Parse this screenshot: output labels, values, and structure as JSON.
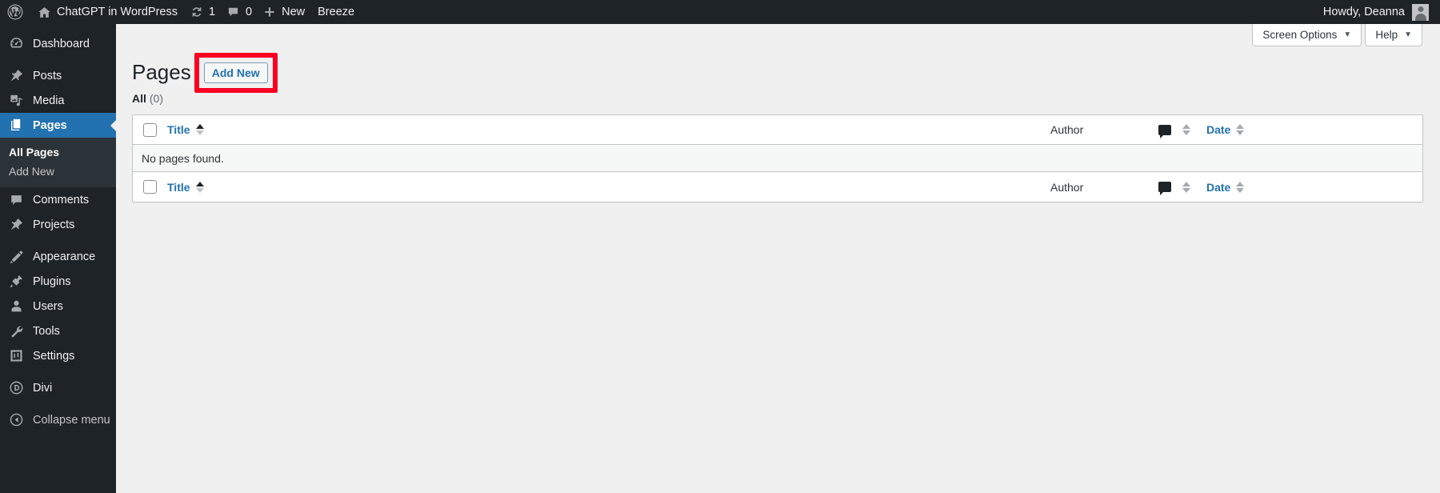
{
  "adminbar": {
    "wp_logo_icon": "wordpress-logo-icon",
    "site_home_icon": "home-icon",
    "site_name": "ChatGPT in WordPress",
    "updates_icon": "updates-icon",
    "updates_count": "1",
    "comments_icon": "comment-bubble-icon",
    "comments_count": "0",
    "new_icon": "plus-icon",
    "new_label": "New",
    "breeze_label": "Breeze",
    "howdy_label": "Howdy, Deanna",
    "avatar_name": "user-avatar"
  },
  "sidebar": {
    "items": [
      {
        "label": "Dashboard",
        "icon": "dashboard-icon",
        "name": "dashboard"
      },
      {
        "label": "Posts",
        "icon": "pin-icon",
        "name": "posts"
      },
      {
        "label": "Media",
        "icon": "media-icon",
        "name": "media"
      },
      {
        "label": "Pages",
        "icon": "pages-icon",
        "name": "pages",
        "current": true
      },
      {
        "label": "Comments",
        "icon": "comment-bubble-icon",
        "name": "comments"
      },
      {
        "label": "Projects",
        "icon": "pin-icon",
        "name": "projects"
      },
      {
        "label": "Appearance",
        "icon": "paintbrush-icon",
        "name": "appearance"
      },
      {
        "label": "Plugins",
        "icon": "plug-icon",
        "name": "plugins"
      },
      {
        "label": "Users",
        "icon": "user-icon",
        "name": "users"
      },
      {
        "label": "Tools",
        "icon": "wrench-icon",
        "name": "tools"
      },
      {
        "label": "Settings",
        "icon": "settings-sliders-icon",
        "name": "settings"
      },
      {
        "label": "Divi",
        "icon": "divi-icon",
        "name": "divi"
      }
    ],
    "submenu": [
      {
        "label": "All Pages",
        "current": true
      },
      {
        "label": "Add New",
        "current": false
      }
    ],
    "collapse": {
      "label": "Collapse menu",
      "icon": "collapse-arrow-icon"
    }
  },
  "screen_meta": {
    "screen_options_label": "Screen Options",
    "help_label": "Help",
    "caret": "▼"
  },
  "page": {
    "title": "Pages",
    "add_new_label": "Add New",
    "highlight_color": "#fb0021"
  },
  "filters": {
    "all_label": "All",
    "all_count": "(0)"
  },
  "table": {
    "columns": {
      "title": "Title",
      "author": "Author",
      "comments_icon": "comment-bubble-icon",
      "date": "Date"
    },
    "empty_message": "No pages found.",
    "select_all_name": "select-all-checkbox"
  }
}
